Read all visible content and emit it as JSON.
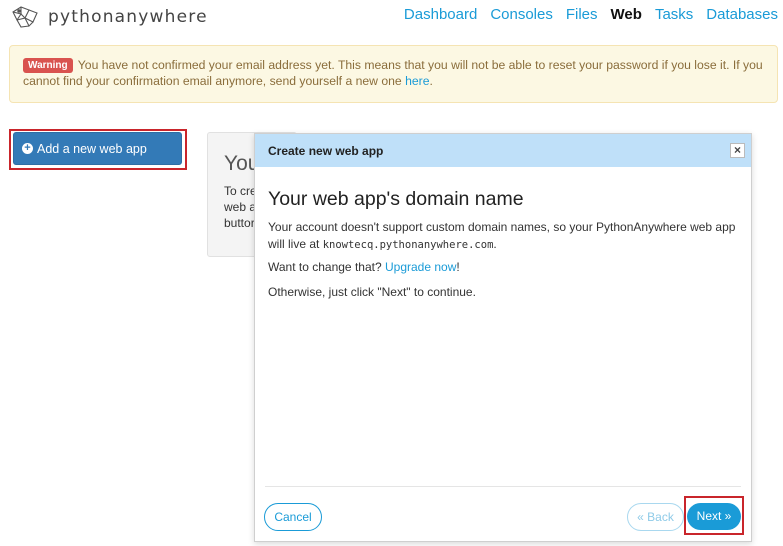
{
  "header": {
    "logo_text": "pythonanywhere",
    "nav": [
      {
        "label": "Dashboard"
      },
      {
        "label": "Consoles"
      },
      {
        "label": "Files"
      },
      {
        "label": "Web"
      },
      {
        "label": "Tasks"
      },
      {
        "label": "Databases"
      }
    ],
    "active_nav": "Web"
  },
  "warning": {
    "badge": "Warning",
    "text": "You have not confirmed your email address yet. This means that you will not be able to reset your password if you lose it. If you cannot find your confirmation email anymore, send yourself a new one",
    "link": "here",
    "end": "."
  },
  "sidebar": {
    "add_button_label": "Add a new web app"
  },
  "background_panel": {
    "title": "You",
    "lines": [
      "To cre",
      "web a",
      "buttor"
    ]
  },
  "modal": {
    "header": "Create new web app",
    "close": "×",
    "title": "Your web app's domain name",
    "p1_a": "Your account doesn't support custom domain names, so your PythonAnywhere web app will live at",
    "domain": "knowtecq.pythonanywhere.com",
    "p1_end": ".",
    "p2_a": "Want to change that?",
    "p2_link": "Upgrade now",
    "p2_end": "!",
    "p3": "Otherwise, just click \"Next\" to continue.",
    "cancel": "Cancel",
    "back": "« Back",
    "next": "Next »"
  },
  "colors": {
    "accent": "#1a9bd7",
    "primary_button": "#337ab7",
    "modal_header": "#bfe0f9",
    "warning_bg": "#fcf8e3",
    "badge": "#d9534f",
    "highlight": "#c9252b"
  }
}
